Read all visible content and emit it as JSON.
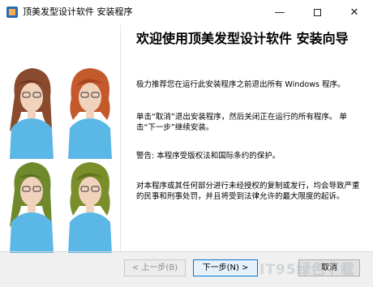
{
  "window": {
    "title": "顶美发型设计软件 安装程序",
    "minimize": "—",
    "close": "✕"
  },
  "wizard": {
    "heading": "欢迎使用顶美发型设计软件 安装向导",
    "para1": "极力推荐您在运行此安装程序之前退出所有 Windows 程序。",
    "para2": "单击“取消”退出安装程序，然后关闭正在运行的所有程序。  单击“下一步”继续安装。",
    "para3": "警告:  本程序受版权法和国际条约的保护。",
    "para4": "对本程序或其任何部分进行未经授权的复制或发行，均会导致严重的民事和刑事处罚，并且将受到法律允许的最大限度的起诉。"
  },
  "buttons": {
    "back": "< 上一步(B)",
    "next": "下一步(N) >",
    "cancel": "取消"
  },
  "watermark": "IT95绿色下载"
}
